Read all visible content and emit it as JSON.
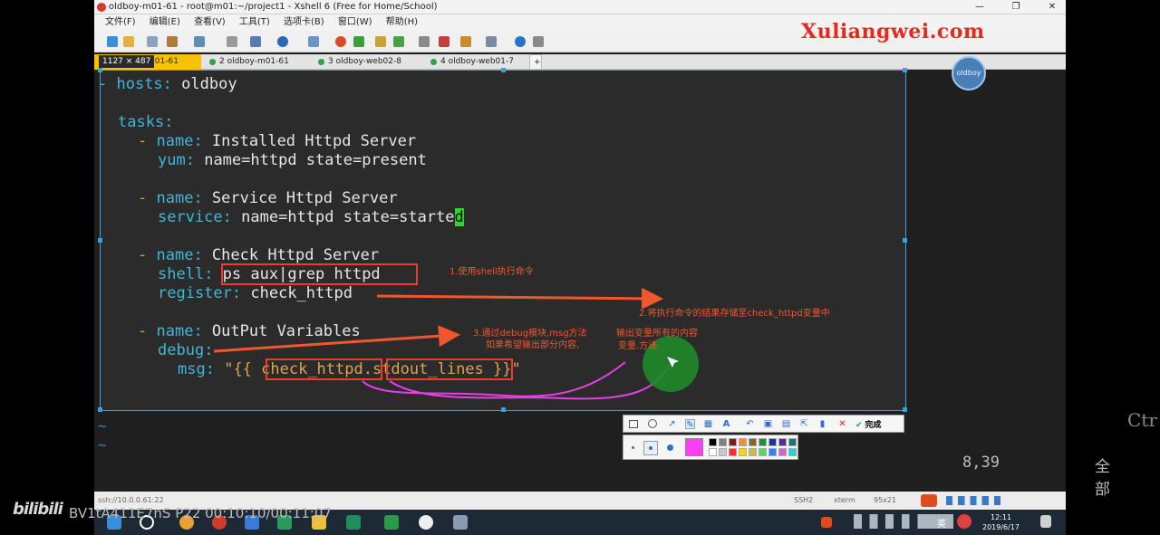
{
  "window": {
    "title": "oldboy-m01-61 - root@m01:~/project1 - Xshell 6 (Free for Home/School)",
    "minimize": "—",
    "maximize": "❐",
    "close": "✕"
  },
  "menu": [
    "文件(F)",
    "编辑(E)",
    "查看(V)",
    "工具(T)",
    "选项卡(B)",
    "窗口(W)",
    "帮助(H)"
  ],
  "size_badge": "1127 × 487",
  "tabs": [
    {
      "label": "m01-61"
    },
    {
      "label": "2 oldboy-m01-61"
    },
    {
      "label": "3 oldboy-web02-8"
    },
    {
      "label": "4 oldboy-web01-7"
    }
  ],
  "tab_add": "+",
  "watermark": "Xuliangwei.com",
  "avatar_text": "oldboy",
  "code": {
    "l1_dash": "- ",
    "l1_key": "hosts",
    "l1_val": " oldboy",
    "l2_key": "tasks",
    "t1_name_key": "name",
    "t1_name_val": " Installed Httpd Server",
    "t1_mod_key": "yum",
    "t1_mod_val": " name=httpd state=present",
    "t2_name_key": "name",
    "t2_name_val": " Service Httpd Server",
    "t2_mod_key": "service",
    "t2_mod_val": " name=httpd state=starte",
    "t2_cursor": "d",
    "t3_name_key": "name",
    "t3_name_val": " Check Httpd Server",
    "t3_mod_key": "shell",
    "t3_mod_val": " ps aux|grep httpd",
    "t3_reg_key": "register",
    "t3_reg_val": " check_httpd",
    "t4_name_key": "name",
    "t4_name_val": " OutPut Variables",
    "t4_mod_key": "debug",
    "t4_msg_key": "msg",
    "t4_msg_val": " \"{{ check_httpd.stdout_lines }}\"",
    "tilde1": "~",
    "tilde2": "~"
  },
  "annotations": {
    "note1": "1.使用shell执行命令",
    "note2": "2.将执行命令的结果存储至check_httpd变量中",
    "note3a": "3.通过debug模块,msg方法",
    "note3b": "如果希望输出部分内容,",
    "note4a": "输出变量所有的内容",
    "note4b": "变量.方法"
  },
  "annotation_toolbar": {
    "done": "完成"
  },
  "palette_colors": [
    "#ff3ef5",
    "#000000",
    "#808080",
    "#7f1d1d",
    "#ff8c1a",
    "#8b6914",
    "#1f8f3a",
    "#1b3a8f",
    "#5b2a8f",
    "#137a7a",
    "#ffffff",
    "#c8c8c8",
    "#ff2a2a",
    "#ffd700",
    "#c0c050",
    "#5cd65c",
    "#3a7ff0",
    "#cc66cc",
    "#2ad2d2"
  ],
  "vim_status": {
    "position": "8,39",
    "scope": "全部",
    "ctrl_hint": "Ctr"
  },
  "status_bar": {
    "conn": "ssh://10.0.0.61:22",
    "proto": "SSH2",
    "term": "xterm",
    "size": "95x21"
  },
  "taskbar": {
    "time": "12:11",
    "date": "2019/6/17",
    "lang": "英"
  },
  "overlay": {
    "logo": "bilibili",
    "video_id": "BV1tA411E7nS P22 00:10:10/00:11:07"
  }
}
